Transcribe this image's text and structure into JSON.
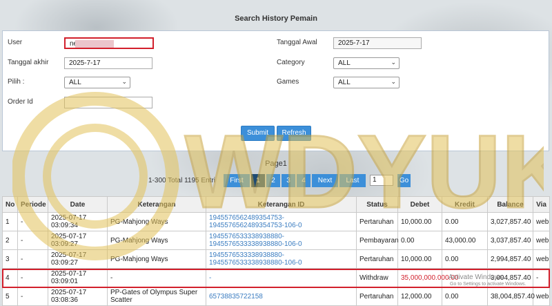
{
  "title": "Search History Pemain",
  "form": {
    "user_label": "User",
    "user_value": "ne",
    "tanggal_akhir_label": "Tanggal akhir",
    "tanggal_akhir_value": "2025-7-17",
    "pilih_label": "Pilih  :",
    "pilih_value": "ALL",
    "order_id_label": "Order Id",
    "order_id_value": "",
    "tanggal_awal_label": "Tanggal Awal",
    "tanggal_awal_value": "2025-7-17",
    "category_label": "Category",
    "category_value": "ALL",
    "games_label": "Games",
    "games_value": "ALL",
    "submit_label": "Submit",
    "refresh_label": "Refresh"
  },
  "pagination": {
    "page_title": "Page1",
    "info": "1-300 Total 1195 Entri",
    "first": "First",
    "pages": [
      "1",
      "2",
      "3",
      "4"
    ],
    "current_page": "1",
    "next": "Next",
    "last": "Last",
    "go": "Go",
    "input_value": "1"
  },
  "table": {
    "headers": [
      "No",
      "Periode",
      "Date",
      "Keterangan",
      "Keterangan ID",
      "Status",
      "Debet",
      "Kredit",
      "Balance",
      "Via"
    ],
    "rows": [
      [
        "1",
        "-",
        "2025-07-17 03:09:34",
        "PG-Mahjong Ways",
        "1945576562489354753-1945576562489354753-106-0",
        "Pertaruhan",
        "10,000.00",
        "0.00",
        "3,027,857.40",
        "web"
      ],
      [
        "2",
        "-",
        "2025-07-17 03:09:27",
        "PG-Mahjong Ways",
        "1945576533338938880-1945576533338938880-106-0",
        "Pembayaran",
        "0.00",
        "43,000.00",
        "3,037,857.40",
        "web"
      ],
      [
        "3",
        "-",
        "2025-07-17 03:09:27",
        "PG-Mahjong Ways",
        "1945576533338938880-1945576533338938880-106-0",
        "Pertaruhan",
        "10,000.00",
        "0.00",
        "2,994,857.40",
        "web"
      ],
      [
        "4",
        "-",
        "2025-07-17 03:09:01",
        "-",
        "-",
        "Withdraw",
        "35,000,000.00",
        "0.00",
        "3,004,857.40",
        "-"
      ],
      [
        "5",
        "-",
        "2025-07-17 03:08:36",
        "PP-Gates of Olympus Super Scatter",
        "65738835722158",
        "Pertaruhan",
        "12,000.00",
        "0.00",
        "38,004,857.40",
        "web"
      ]
    ]
  },
  "watermark_text": "WDYUK",
  "activate_windows": "Activate Windows",
  "activate_windows_sub": "Go to Settings to activate Windows.",
  "colors": {
    "accent": "#3c8fd9",
    "active_page": "#1f4b73",
    "highlight": "#d21f2b",
    "link": "#3a7cc0",
    "watermark": "#e3c35a"
  }
}
